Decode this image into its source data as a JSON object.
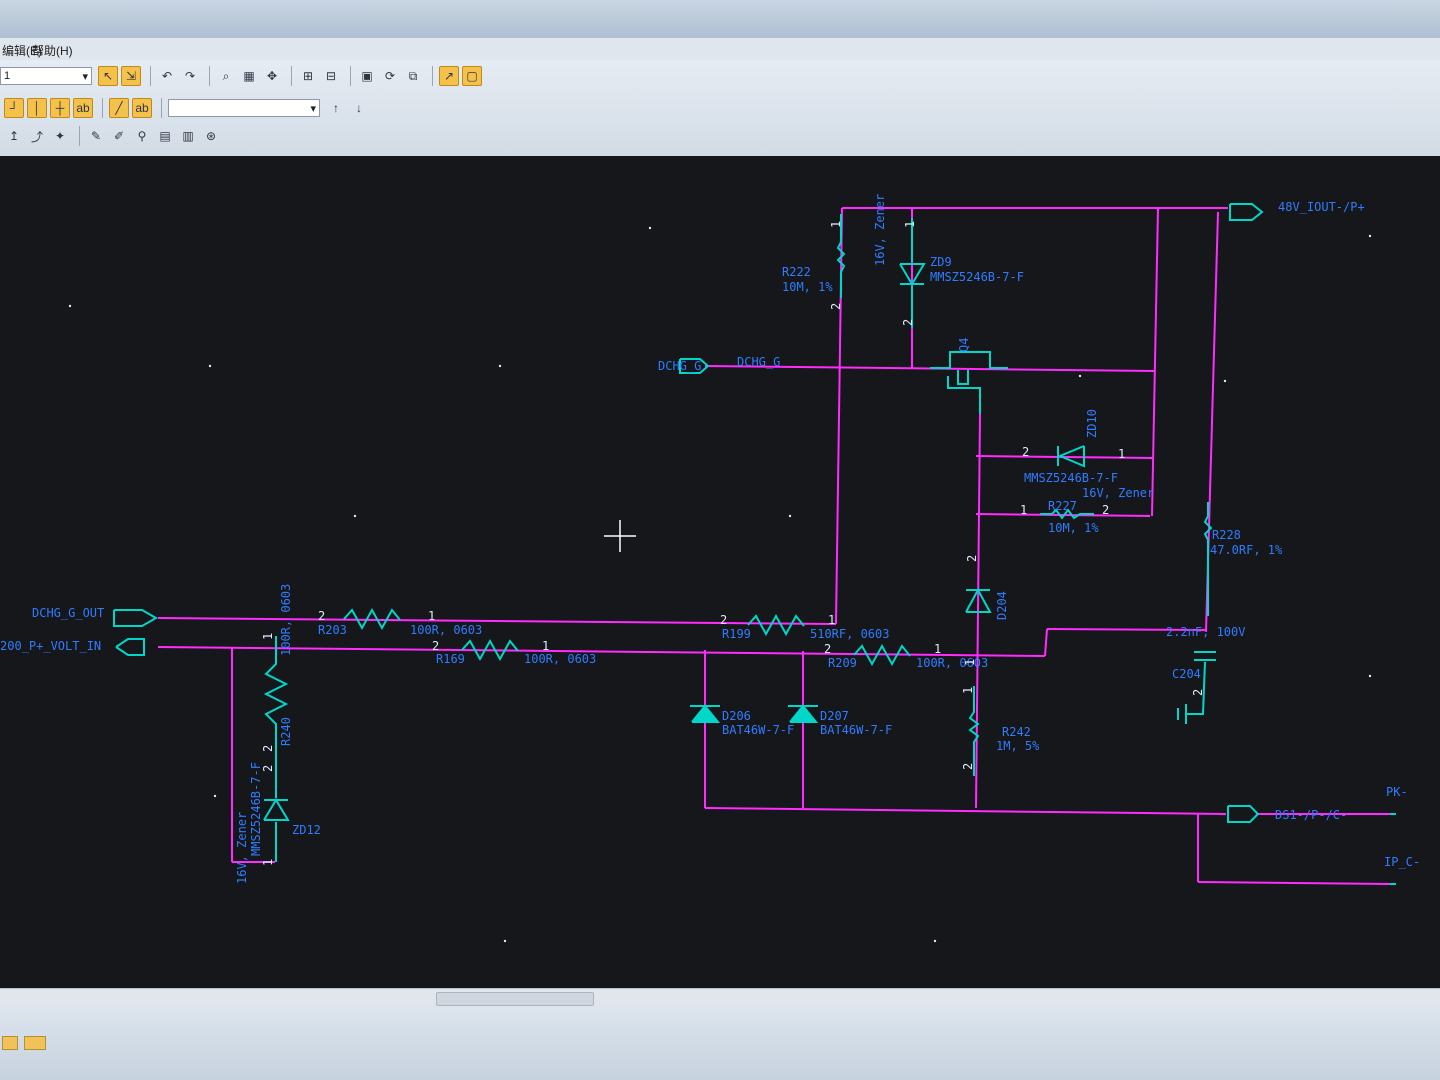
{
  "window": {
    "title": ""
  },
  "menu": {
    "items": [
      "编辑(E)",
      "帮助(H)"
    ]
  },
  "toolbar": {
    "selector_value": "1",
    "text_combo_value": "",
    "buttons": [
      "select-wire-icon",
      "select-component-icon",
      "undo-icon",
      "redo-icon",
      "zoom-icon",
      "zoom-area-icon",
      "pan-icon",
      "fit-icon",
      "grid-icon",
      "place-part-icon",
      "rotate-icon",
      "mirror-icon",
      "add-text-icon",
      "move-up-icon",
      "move-down-icon"
    ]
  },
  "schematic": {
    "ports": {
      "out_48v": "48V_IOUT-/P+",
      "dchg_g_port": "DCHG_G",
      "dchg_g_out": "DCHG_G_OUT",
      "volt_in": "200_P+_VOLT_IN",
      "ds1": "DS1-/P-/C-",
      "pk": "PK-",
      "ip": "IP_C-"
    },
    "net_labels": {
      "dchg_g": "DCHG_G"
    },
    "components": {
      "r222": {
        "ref": "R222",
        "value": "10M, 1%"
      },
      "zd9": {
        "ref": "ZD9",
        "value": "MMSZ5246B-7-F",
        "note": "16V, Zener"
      },
      "q4": {
        "ref": "Q4"
      },
      "zd10": {
        "ref": "ZD10",
        "value": "MMSZ5246B-7-F",
        "note": "16V, Zener"
      },
      "r227": {
        "ref": "R227",
        "value": "10M, 1%"
      },
      "r228": {
        "ref": "R228",
        "value": "47.0RF, 1%"
      },
      "d204": {
        "ref": "D204"
      },
      "c204": {
        "ref": "C204",
        "value": "2.2nF, 100V"
      },
      "r203": {
        "ref": "R203",
        "value": "100R, 0603"
      },
      "r199": {
        "ref": "R199",
        "value": "510RF, 0603"
      },
      "r169": {
        "ref": "R169",
        "value": "100R, 0603"
      },
      "r209": {
        "ref": "R209",
        "value": "100R, 0603"
      },
      "r240": {
        "ref": "R240",
        "value": "100R, 0603"
      },
      "zd12": {
        "ref": "ZD12",
        "value": "MMSZ5246B-7-F",
        "note": "16V, Zener"
      },
      "d206": {
        "ref": "D206",
        "value": "BAT46W-7-F"
      },
      "d207": {
        "ref": "D207",
        "value": "BAT46W-7-F"
      },
      "r242": {
        "ref": "R242",
        "value": "1M, 5%"
      }
    },
    "pins": {
      "one": "1",
      "two": "2"
    }
  },
  "colors": {
    "wire": "#ff2bff",
    "component": "#00d7c8",
    "label": "#2f7cff",
    "canvas": "#16171b"
  }
}
